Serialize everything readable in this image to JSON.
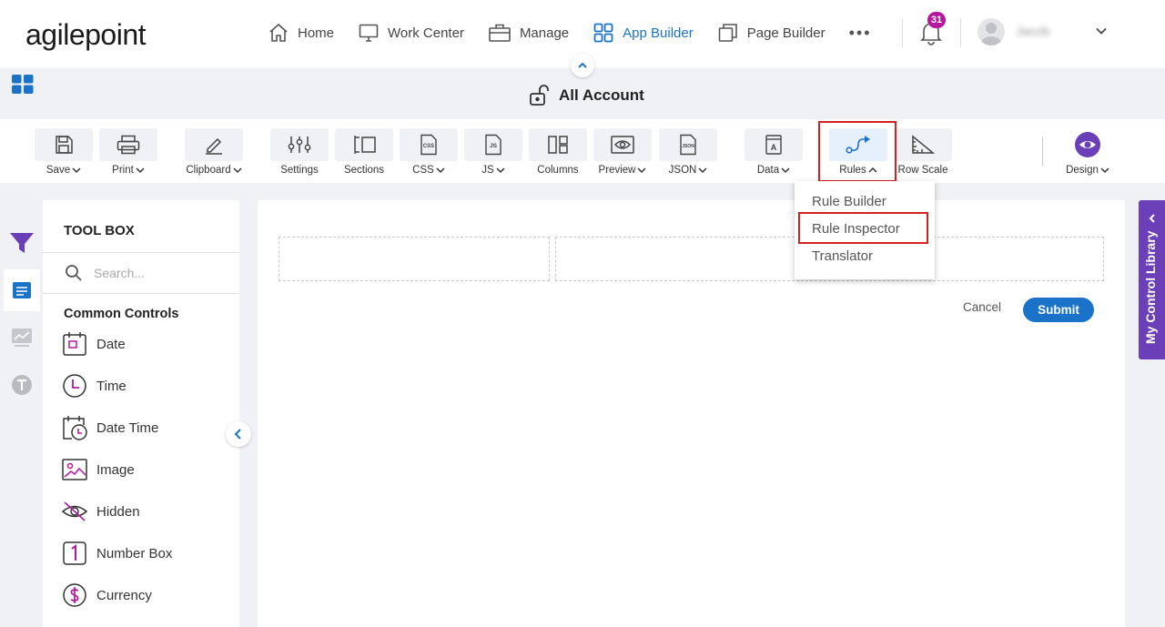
{
  "brand": {
    "logo_text": "agilepoint"
  },
  "nav": {
    "items": [
      {
        "label": "Home",
        "icon": "home-icon"
      },
      {
        "label": "Work Center",
        "icon": "monitor-icon"
      },
      {
        "label": "Manage",
        "icon": "briefcase-icon"
      },
      {
        "label": "App Builder",
        "icon": "grid-icon",
        "active": true
      },
      {
        "label": "Page Builder",
        "icon": "pages-icon"
      }
    ],
    "more": "•••",
    "notification_count": "31",
    "user_name": "Jacob"
  },
  "page": {
    "title": "All Account"
  },
  "toolbar": {
    "save": "Save",
    "print": "Print",
    "clipboard": "Clipboard",
    "settings": "Settings",
    "sections": "Sections",
    "css": "CSS",
    "js": "JS",
    "columns": "Columns",
    "preview": "Preview",
    "json": "JSON",
    "data": "Data",
    "rules": "Rules",
    "row_scale": "Row Scale",
    "design": "Design"
  },
  "rules_menu": {
    "items": [
      "Rule Builder",
      "Rule Inspector",
      "Translator"
    ],
    "highlighted": "Rule Inspector"
  },
  "toolbox": {
    "title": "TOOL BOX",
    "search_placeholder": "Search...",
    "section": "Common Controls",
    "controls": [
      "Date",
      "Time",
      "Date Time",
      "Image",
      "Hidden",
      "Number Box",
      "Currency"
    ]
  },
  "form": {
    "cancel": "Cancel",
    "submit": "Submit"
  },
  "side_tab": {
    "label": "My Control Library"
  },
  "colors": {
    "accent": "#1a73c8",
    "purple": "#6b3fb8",
    "badge": "#b5179e",
    "highlight": "#d42222"
  }
}
